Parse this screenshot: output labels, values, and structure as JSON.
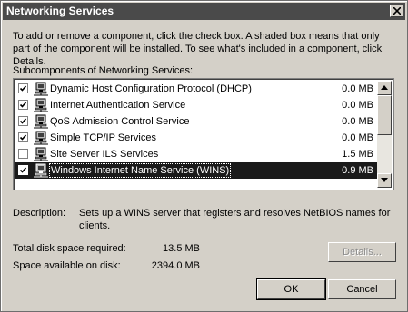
{
  "window": {
    "title": "Networking Services"
  },
  "intro_text": "To add or remove a component, click the check box. A shaded box means that only part of the component will be installed. To see what's included in a component, click Details.",
  "subcomponents_label": "Subcomponents of Networking Services:",
  "components": [
    {
      "label": "Dynamic Host Configuration Protocol (DHCP)",
      "size": "0.0 MB",
      "checked": true,
      "selected": false
    },
    {
      "label": "Internet Authentication Service",
      "size": "0.0 MB",
      "checked": true,
      "selected": false
    },
    {
      "label": "QoS Admission Control Service",
      "size": "0.0 MB",
      "checked": true,
      "selected": false
    },
    {
      "label": "Simple TCP/IP Services",
      "size": "0.0 MB",
      "checked": true,
      "selected": false
    },
    {
      "label": "Site Server ILS Services",
      "size": "1.5 MB",
      "checked": false,
      "selected": false
    },
    {
      "label": "Windows Internet Name Service (WINS)",
      "size": "0.9 MB",
      "checked": true,
      "selected": true
    }
  ],
  "description": {
    "label": "Description:",
    "text": "Sets up a WINS server that registers and resolves NetBIOS names for clients."
  },
  "disk": {
    "required_label": "Total disk space required:",
    "required_value": "13.5 MB",
    "available_label": "Space available on disk:",
    "available_value": "2394.0 MB"
  },
  "buttons": {
    "details": "Details...",
    "ok": "OK",
    "cancel": "Cancel"
  },
  "icons": {
    "close": "close-icon",
    "checkbox": "checkmark-icon",
    "component": "network-computer-icon",
    "scroll_up": "arrow-up-icon",
    "scroll_down": "arrow-down-icon"
  }
}
